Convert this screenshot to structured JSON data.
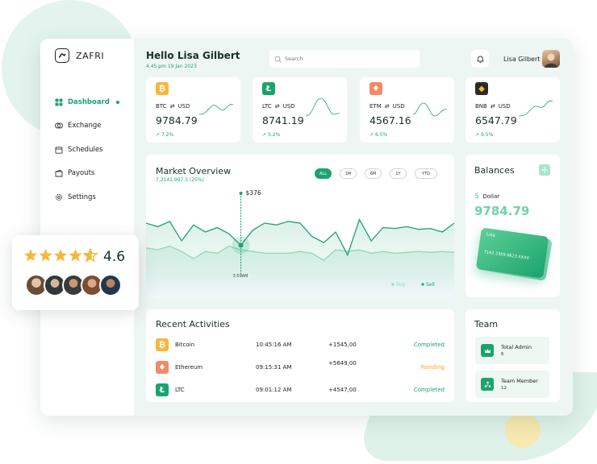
{
  "brand": {
    "name": "ZAFRI"
  },
  "nav": [
    {
      "label": "Dashboard",
      "icon": "grid-icon",
      "active": true
    },
    {
      "label": "Exchange",
      "icon": "exchange-icon"
    },
    {
      "label": "Schedules",
      "icon": "calendar-icon"
    },
    {
      "label": "Payouts",
      "icon": "wallet-icon"
    },
    {
      "label": "Settings",
      "icon": "gear-icon"
    }
  ],
  "header": {
    "greeting": "Hello Lisa Gilbert",
    "datetime": "4.45 pm 19 Jan 2023",
    "search_placeholder": "Search",
    "user_name": "Lisa Gilbert"
  },
  "coins": [
    {
      "symbol": "BTC",
      "quote": "USD",
      "price": "9784.79",
      "change": "7.2%",
      "color": "#f6b73c",
      "glyph": "₿",
      "icon": "bitcoin-icon"
    },
    {
      "symbol": "LTC",
      "quote": "USD",
      "price": "8741.19",
      "change": "5.2%",
      "color": "#1ba36e",
      "glyph": "Ł",
      "icon": "litecoin-icon"
    },
    {
      "symbol": "ETM",
      "quote": "USD",
      "price": "4567.16",
      "change": "6.5%",
      "color": "#f28a67",
      "glyph": "♦",
      "icon": "ethereum-icon"
    },
    {
      "symbol": "BNB",
      "quote": "USD",
      "price": "6547.79",
      "change": "9.5%",
      "color": "#2b2b24",
      "glyph": "◆",
      "icon": "bnb-icon"
    }
  ],
  "market": {
    "title": "Market Overview",
    "subtitle": "7,2141,997.5 (25%)",
    "ranges": [
      "ALL",
      "1M",
      "6M",
      "1Y",
      "YTD"
    ],
    "active_range": "ALL",
    "tooltip_value": "$376",
    "tooltip_time": "3:59AM",
    "legend": [
      "Buy",
      "Sell"
    ]
  },
  "chart_data": {
    "type": "line",
    "title": "Market Overview",
    "x": [
      0,
      1,
      2,
      3,
      4,
      5,
      6,
      7,
      8,
      9,
      10,
      11,
      12,
      13,
      14,
      15,
      16,
      17,
      18,
      19,
      20,
      21,
      22,
      23,
      24,
      25,
      26
    ],
    "series": [
      {
        "name": "Sell",
        "values": [
          70,
          66,
          72,
          50,
          68,
          60,
          65,
          58,
          45,
          62,
          70,
          68,
          72,
          70,
          55,
          48,
          60,
          34,
          74,
          50,
          65,
          64,
          66,
          63,
          64,
          60,
          70
        ]
      },
      {
        "name": "Buy",
        "values": [
          42,
          40,
          44,
          38,
          30,
          38,
          36,
          44,
          40,
          38,
          36,
          36,
          36,
          38,
          36,
          28,
          40,
          38,
          40,
          36,
          38,
          36,
          37,
          38,
          37,
          38,
          37
        ]
      }
    ],
    "highlight_index": 8,
    "grid": false,
    "legend_position": "bottom-right"
  },
  "balances": {
    "title": "Balances",
    "currency": "Dollar",
    "amount": "9784.79",
    "card_name": "Lisa",
    "card_number": "7162 2309 8623 XXXX"
  },
  "activities": {
    "title": "Recent Activities",
    "rows": [
      {
        "name": "Bitcoin",
        "time": "10:45:16 AM",
        "amount": "+1545,00",
        "status": "Completed",
        "status_color": "#1ba36e",
        "color": "#f6b73c",
        "glyph": "₿",
        "icon": "bitcoin-icon"
      },
      {
        "name": "Ethereum",
        "time": "09:15:31 AM",
        "amount": "+5649,00",
        "status": "Painding",
        "status_color": "#f2a626",
        "color": "#f28a67",
        "glyph": "♦",
        "icon": "ethereum-icon"
      },
      {
        "name": "LTC",
        "time": "09:01:12 AM",
        "amount": "+4547,00",
        "status": "Completed",
        "status_color": "#1ba36e",
        "color": "#1ba36e",
        "glyph": "Ł",
        "icon": "litecoin-icon"
      }
    ]
  },
  "team": {
    "title": "Team",
    "items": [
      {
        "label": "Total Admin",
        "count": "6",
        "icon": "admin-icon"
      },
      {
        "label": "Team Member",
        "count": "12",
        "icon": "people-icon"
      }
    ]
  },
  "rating": {
    "value": "4.6",
    "stars": 4.6,
    "star_color": "#f6b73c"
  }
}
